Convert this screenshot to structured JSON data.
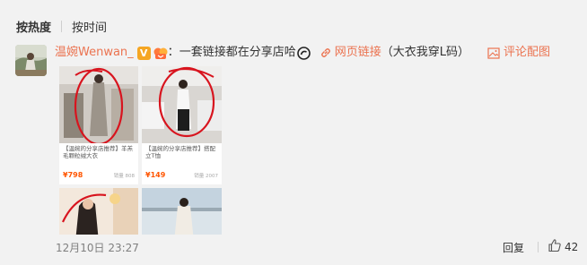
{
  "sort_tabs": {
    "hot": "按热度",
    "time": "按时间"
  },
  "comment": {
    "username": "温婉Wenwan_",
    "v_badge": "V",
    "colon": "：",
    "text": "一套链接都在分享店哈",
    "link_label": "网页链接",
    "link_note": "（大衣我穿L码）",
    "pic_label": "评论配图",
    "date": "12月10日 23:27",
    "reply_label": "回复",
    "like_count": "42"
  },
  "product_cards": [
    {
      "title": "【温婉的分享店推荐】羊羔毛颗粒绒大衣",
      "price": "¥798",
      "sales": "销量 808"
    },
    {
      "title": "【温婉的分享店推荐】搭配立T恤",
      "price": "¥149",
      "sales": "销量 2007"
    },
    {
      "title": "",
      "price": "",
      "sales": ""
    },
    {
      "title": "",
      "price": "",
      "sales": ""
    }
  ],
  "colors": {
    "accent": "#eb7350",
    "price": "#ff5500",
    "background": "#f2f2f2"
  },
  "icons": [
    "link-icon",
    "image-icon",
    "thumb-up-icon",
    "weibo-link-icon",
    "fan-badge-icon"
  ]
}
